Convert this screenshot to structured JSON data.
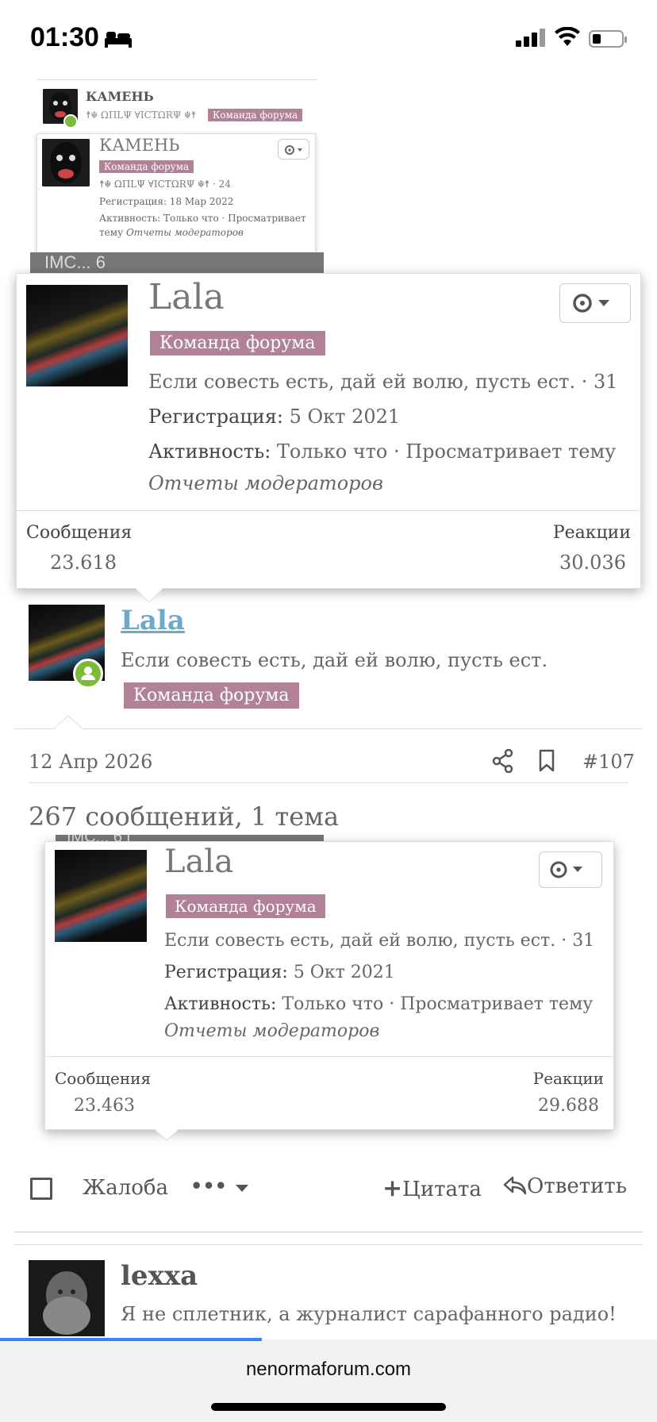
{
  "status": {
    "time": "01:30"
  },
  "bg_user": {
    "name": "КАМЕНЬ",
    "tagline": "☨☬ ΩΠLΨ ∀ICTΩRΨ ☬☨",
    "badge": "Команда форума",
    "tagline_count": "☨☬ ΩΠLΨ ∀ICTΩRΨ ☬☨ · 24",
    "registration": "Регистрация: 18 Мар 2022",
    "activity": "Активность: Только что · Просматривает",
    "activity_tail_prefix": "тему ",
    "activity_tail_italic": "Отчеты модераторов",
    "strip_text": "IMC... 6"
  },
  "popup_top": {
    "name": "Lala",
    "badge": "Команда форума",
    "tagline": "Если совесть есть, дай ей волю, пусть ест. · 31",
    "registration_label": "Регистрация:",
    "registration_value": "5 Окт 2021",
    "activity_label": "Активность:",
    "activity_value": "Только что · Просматривает тему",
    "activity_italic": "Отчеты модераторов",
    "messages_label": "Сообщения",
    "messages_value": "23.618",
    "reactions_label": "Реакции",
    "reactions_value": "30.036"
  },
  "post": {
    "author": "Lala",
    "tagline": "Если совесть есть, дай ей волю, пусть ест.",
    "badge": "Команда форума",
    "date": "12 Апр 2026",
    "number": "#107",
    "body_text": "267 сообщений, 1 тема",
    "strip_text": "IMC... 6 i"
  },
  "popup_bottom": {
    "name": "Lala",
    "badge": "Команда форума",
    "tagline": "Если совесть есть, дай ей волю, пусть ест. · 31",
    "registration_label": "Регистрация:",
    "registration_value": "5 Окт 2021",
    "activity_label": "Активность:",
    "activity_value": "Только что · Просматривает тему",
    "activity_italic": "Отчеты модераторов",
    "messages_label": "Сообщения",
    "messages_value": "23.463",
    "reactions_label": "Реакции",
    "reactions_value": "29.688"
  },
  "actions": {
    "report": "Жалоба",
    "more": "•••",
    "quote": "Цитата",
    "reply": "Ответить"
  },
  "next_post": {
    "author": "lexxa",
    "tagline": "Я не сплетник, а журналист сарафанного радио!"
  },
  "browser": {
    "url": "nenormaforum.com"
  }
}
